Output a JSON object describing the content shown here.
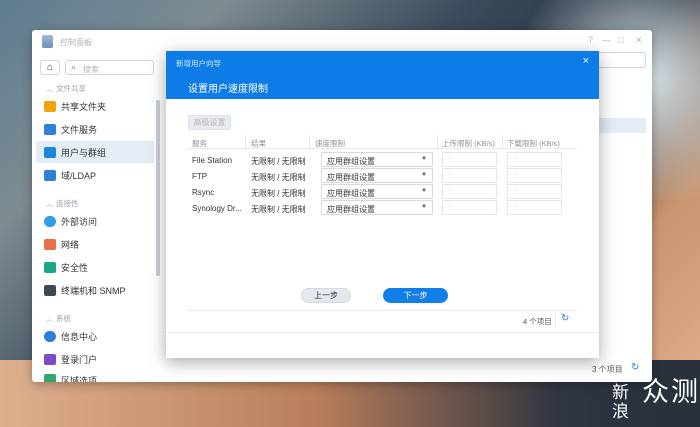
{
  "control_panel": {
    "title": "控制面板",
    "window_controls": [
      "?",
      "—",
      "□",
      "✕"
    ],
    "search_placeholder": "搜索",
    "categories": [
      {
        "label": "文件共享"
      },
      {
        "label": "连接性"
      },
      {
        "label": "系统"
      }
    ],
    "items": [
      {
        "label": "共享文件夹",
        "icon": "folder-icon",
        "color": "#f0a30a"
      },
      {
        "label": "文件服务",
        "icon": "file-services-icon",
        "color": "#2f7fd7"
      },
      {
        "label": "用户与群组",
        "icon": "users-icon",
        "color": "#1c86d8"
      },
      {
        "label": "域/LDAP",
        "icon": "domain-icon",
        "color": "#2f7fd7"
      },
      {
        "label": "外部访问",
        "icon": "external-access-icon",
        "color": "#2f9fe8"
      },
      {
        "label": "网络",
        "icon": "network-icon",
        "color": "#e8704a"
      },
      {
        "label": "安全性",
        "icon": "shield-icon",
        "color": "#1aa889"
      },
      {
        "label": "终端机和 SNMP",
        "icon": "terminal-icon",
        "color": "#3d4a56"
      },
      {
        "label": "信息中心",
        "icon": "info-icon",
        "color": "#2f7fd7"
      },
      {
        "label": "登录门户",
        "icon": "login-portal-icon",
        "color": "#7b4cc9"
      },
      {
        "label": "区域选项",
        "icon": "region-icon",
        "color": "#2fa86a"
      }
    ],
    "footer_count": "3 个项目"
  },
  "wizard": {
    "title": "新增用户向导",
    "subtitle": "设置用户速度限制",
    "advanced_button": "高级设置",
    "columns": [
      "服务",
      "结果",
      "速度限制",
      "上传限制 (KB/s)",
      "下载限制 (KB/s)"
    ],
    "rows": [
      {
        "service": "File Station",
        "result": "无限制 / 无限制",
        "limit": "应用群组设置",
        "upload": "-",
        "download": "-"
      },
      {
        "service": "FTP",
        "result": "无限制 / 无限制",
        "limit": "应用群组设置",
        "upload": "-",
        "download": "-"
      },
      {
        "service": "Rsync",
        "result": "无限制 / 无限制",
        "limit": "应用群组设置",
        "upload": "-",
        "download": "-"
      },
      {
        "service": "Synology Dr...",
        "result": "无限制 / 无限制",
        "limit": "应用群组设置",
        "upload": "-",
        "download": "-"
      }
    ],
    "item_count": "4 个项目",
    "prev_button": "上一步",
    "next_button": "下一步"
  },
  "watermark": {
    "line1": "新",
    "line2": "浪",
    "big": "众测"
  }
}
